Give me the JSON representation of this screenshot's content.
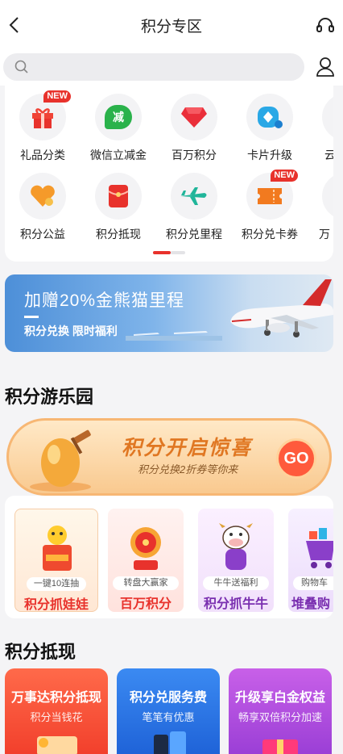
{
  "header": {
    "title": "积分专区"
  },
  "search": {
    "placeholder": ""
  },
  "grid": {
    "row1": [
      {
        "label": "礼品分类",
        "icon": "gift-icon",
        "badge": "NEW"
      },
      {
        "label": "微信立减金",
        "icon": "wechat-discount-icon",
        "glyph": "减"
      },
      {
        "label": "百万积分",
        "icon": "gem-icon"
      },
      {
        "label": "卡片升级",
        "icon": "card-upgrade-icon"
      },
      {
        "label": "云"
      }
    ],
    "row2": [
      {
        "label": "积分公益",
        "icon": "heart-icon"
      },
      {
        "label": "积分抵现",
        "icon": "red-packet-icon"
      },
      {
        "label": "积分兑里程",
        "icon": "airplane-icon"
      },
      {
        "label": "积分兑卡券",
        "icon": "ticket-icon",
        "badge": "NEW"
      },
      {
        "label": "万"
      }
    ]
  },
  "banner": {
    "title": "加赠20%金熊猫里程",
    "subtitle": "积分兑换 限时福利"
  },
  "playground": {
    "title": "积分游乐园",
    "egg": {
      "title": "积分开启惊喜",
      "subtitle": "积分兑换2折券等你来",
      "go": "GO"
    },
    "games": [
      {
        "pill": "一键10连抽",
        "name": "积分抓娃娃",
        "color": "#e8322c"
      },
      {
        "pill": "转盘大赢家",
        "name": "百万积分",
        "color": "#e8322c"
      },
      {
        "pill": "牛牛送福利",
        "name": "积分抓牛牛",
        "color": "#7a2fb0"
      },
      {
        "pill": "购物车",
        "name": "堆叠购",
        "color": "#7a2fb0"
      }
    ]
  },
  "withdraw": {
    "title": "积分抵现",
    "cards": [
      {
        "title": "万事达积分抵现",
        "sub": "积分当钱花"
      },
      {
        "title": "积分兑服务费",
        "sub": "笔笔有优惠"
      },
      {
        "title": "升级享白金权益",
        "sub": "畅享双倍积分加速"
      }
    ]
  }
}
